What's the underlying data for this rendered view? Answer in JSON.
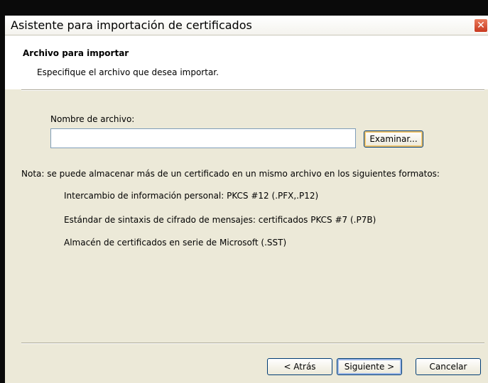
{
  "window": {
    "title": "Asistente para importación de certificados",
    "close_label": "✕"
  },
  "header": {
    "title": "Archivo para importar",
    "subtitle": "Especifique el archivo que desea importar."
  },
  "form": {
    "file_label": "Nombre de archivo:",
    "file_value": "",
    "browse_label": "Examinar..."
  },
  "note": {
    "text": "Nota: se puede almacenar más de un certificado en un mismo archivo en los siguientes formatos:",
    "formats": [
      "Intercambio de información personal: PKCS #12 (.PFX,.P12)",
      "Estándar de sintaxis de cifrado de mensajes: certificados PKCS #7 (.P7B)",
      "Almacén de certificados en serie de Microsoft (.SST)"
    ]
  },
  "footer": {
    "back_label": "< Atrás",
    "next_label": "Siguiente >",
    "cancel_label": "Cancelar"
  }
}
